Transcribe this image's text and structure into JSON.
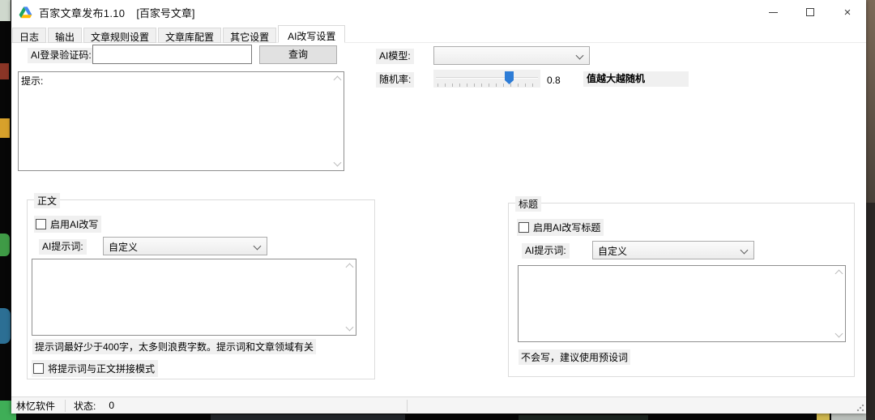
{
  "window": {
    "title": "百家文章发布1.10",
    "context": "[百家号文章]",
    "close_icon": "×"
  },
  "tabs": [
    {
      "label": "日志",
      "active": false
    },
    {
      "label": "输出",
      "active": false
    },
    {
      "label": "文章规则设置",
      "active": false
    },
    {
      "label": "文章库配置",
      "active": false
    },
    {
      "label": "其它设置",
      "active": false
    },
    {
      "label": "AI改写设置",
      "active": true
    }
  ],
  "auth": {
    "label": "AI登录验证码:",
    "value": "",
    "query_button": "查询"
  },
  "model": {
    "label": "AI模型:",
    "selected_value": ""
  },
  "randomness": {
    "label": "随机率:",
    "value": "0.8",
    "note": "值越大越随机"
  },
  "prompt_panel": {
    "text": "提示:"
  },
  "body_group": {
    "title": "正文",
    "enable_label": "启用AI改写",
    "prompt_label": "AI提示词:",
    "prompt_value": "自定义",
    "textarea_value": "",
    "hint": "提示词最好少于400字，太多则浪费字数。提示词和文章领域有关",
    "concat_label": "将提示词与正文拼接模式"
  },
  "title_group": {
    "title": "标题",
    "enable_label": "启用AI改写标题",
    "prompt_label": "AI提示词:",
    "prompt_value": "自定义",
    "textarea_value": "",
    "hint": "不会写，建议使用预设词"
  },
  "statusbar": {
    "brand": "林忆软件",
    "status_label": "状态:",
    "status_value": "0"
  },
  "colors": {
    "slider_thumb": "#2d7cd6",
    "app_icon_green": "#1ea362",
    "app_icon_yellow": "#ffba00",
    "app_icon_blue": "#4688f4"
  }
}
